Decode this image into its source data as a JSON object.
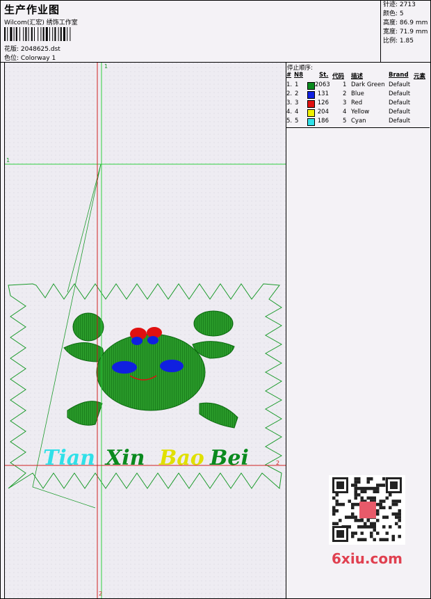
{
  "header": {
    "title": "生产作业图",
    "company": "Wilcom(汇宏) 绣饰工作室",
    "design_label": "花版:",
    "design_value": "2048625.dst",
    "colorway_label": "色位:",
    "colorway_value": "Colorway 1"
  },
  "stats": [
    {
      "label": "针迹:",
      "value": "2713"
    },
    {
      "label": "颜色:",
      "value": "5"
    },
    {
      "label": "高度:",
      "value": "86.9 mm"
    },
    {
      "label": "宽度:",
      "value": "71.9 mm"
    },
    {
      "label": "比例:",
      "value": "1.85"
    }
  ],
  "stop_order": {
    "title": "停止顺序:",
    "columns": [
      "#",
      "N8",
      "St.",
      "代码",
      "描述",
      "Brand",
      "元素"
    ],
    "rows": [
      {
        "idx": "1.",
        "n": "1",
        "st": "2063",
        "code": "1",
        "desc": "Dark Green",
        "brand": "Default",
        "color": "#0a8a1e"
      },
      {
        "idx": "2.",
        "n": "2",
        "st": "131",
        "code": "2",
        "desc": "Blue",
        "brand": "Default",
        "color": "#1020e0"
      },
      {
        "idx": "3.",
        "n": "3",
        "st": "126",
        "code": "3",
        "desc": "Red",
        "brand": "Default",
        "color": "#e01010"
      },
      {
        "idx": "4.",
        "n": "4",
        "st": "204",
        "code": "4",
        "desc": "Yellow",
        "brand": "Default",
        "color": "#f0f000"
      },
      {
        "idx": "5.",
        "n": "5",
        "st": "186",
        "code": "5",
        "desc": "Cyan",
        "brand": "Default",
        "color": "#30e0e8"
      }
    ]
  },
  "design": {
    "text_words": [
      "Tian",
      "Xin",
      "Bao",
      "Bei"
    ],
    "text_colors": [
      "#30e0e8",
      "#0a8a1e",
      "#f0f000",
      "#0a8a1e"
    ],
    "marker_1": "1",
    "marker_2": "2"
  },
  "watermark": {
    "text": "6xiu.com"
  }
}
